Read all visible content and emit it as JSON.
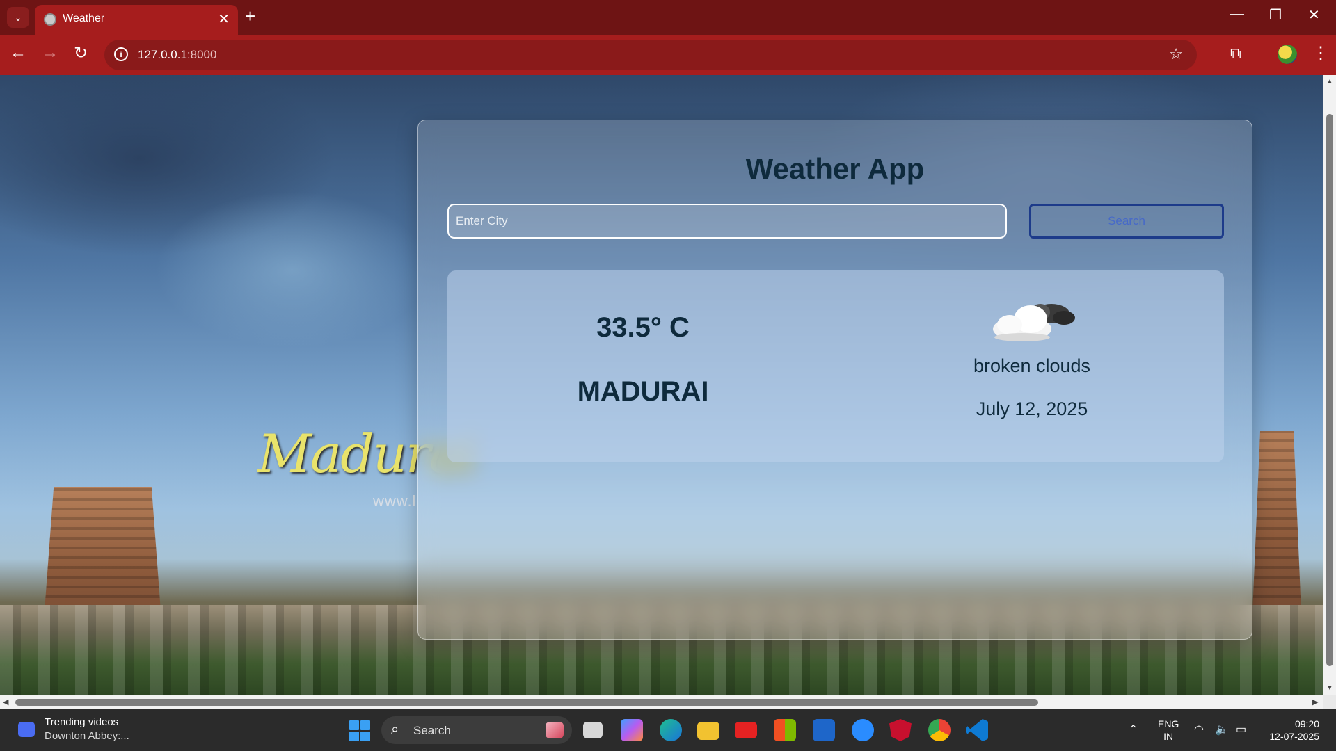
{
  "browser": {
    "tab_title": "Weather",
    "url_host": "127.0.0.1",
    "url_port": ":8000"
  },
  "page": {
    "background_text": "Madurai",
    "background_url": "www.l",
    "title": "Weather App",
    "search": {
      "placeholder": "Enter City",
      "value": "",
      "button_label": "Search"
    },
    "result": {
      "temperature": "33.5° C",
      "city": "MADURAI",
      "description": "broken clouds",
      "date": "July 12, 2025",
      "icon": "broken-clouds-icon"
    }
  },
  "taskbar": {
    "widget_title": "Trending videos",
    "widget_subtitle": "Downton Abbey:...",
    "search_label": "Search",
    "language_line1": "ENG",
    "language_line2": "IN",
    "time": "09:20",
    "date": "12-07-2025"
  },
  "colors": {
    "chrome_tabstrip": "#6e1414",
    "chrome_toolbar": "#a61d1d",
    "title_text": "#0e2a3c",
    "search_border": "#1d3b8a"
  }
}
